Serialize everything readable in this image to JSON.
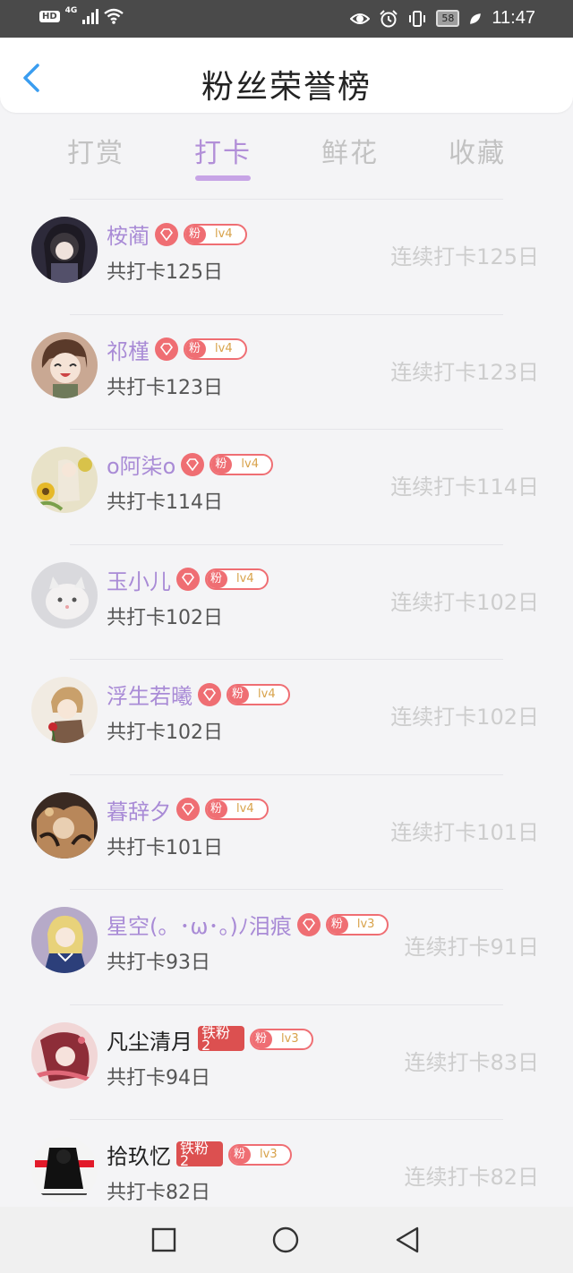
{
  "statusbar": {
    "hd": "HD",
    "network": "4G",
    "battery": "58",
    "time": "11:47"
  },
  "header": {
    "title": "粉丝荣誉榜"
  },
  "tabs": [
    {
      "label": "打赏",
      "active": false
    },
    {
      "label": "打卡",
      "active": true
    },
    {
      "label": "鲜花",
      "active": false
    },
    {
      "label": "收藏",
      "active": false
    }
  ],
  "list": [
    {
      "name": "桉蔺",
      "badge": "fan",
      "fan_label": "粉",
      "level": "lv4",
      "total": "共打卡125日",
      "streak": "连续打卡125日"
    },
    {
      "name": "祁槿",
      "badge": "fan",
      "fan_label": "粉",
      "level": "lv4",
      "total": "共打卡123日",
      "streak": "连续打卡123日"
    },
    {
      "name": "o阿柒o",
      "badge": "fan",
      "fan_label": "粉",
      "level": "lv4",
      "total": "共打卡114日",
      "streak": "连续打卡114日"
    },
    {
      "name": "玉小儿",
      "badge": "fan",
      "fan_label": "粉",
      "level": "lv4",
      "total": "共打卡102日",
      "streak": "连续打卡102日"
    },
    {
      "name": "浮生若曦",
      "badge": "fan",
      "fan_label": "粉",
      "level": "lv4",
      "total": "共打卡102日",
      "streak": "连续打卡102日"
    },
    {
      "name": "暮辞夕",
      "badge": "fan",
      "fan_label": "粉",
      "level": "lv4",
      "total": "共打卡101日",
      "streak": "连续打卡101日"
    },
    {
      "name": "星空(。･ω･。)ﾉ泪痕",
      "badge": "fan",
      "fan_label": "粉",
      "level": "lv3",
      "total": "共打卡93日",
      "streak": "连续打卡91日"
    },
    {
      "name": "凡尘清月",
      "badge": "iron",
      "iron_label": "铁粉",
      "iron_level": "2",
      "fan_label": "粉",
      "level": "lv3",
      "total": "共打卡94日",
      "streak": "连续打卡83日"
    },
    {
      "name": "拾玖忆",
      "badge": "iron",
      "iron_label": "铁粉",
      "iron_level": "2",
      "fan_label": "粉",
      "level": "lv3",
      "total": "共打卡82日",
      "streak": "连续打卡82日"
    }
  ],
  "colors": {
    "accent_purple": "#b28fd8",
    "badge_red": "#ef6e73",
    "iron_red": "#dc5050",
    "level_gold": "#d8a24a"
  }
}
